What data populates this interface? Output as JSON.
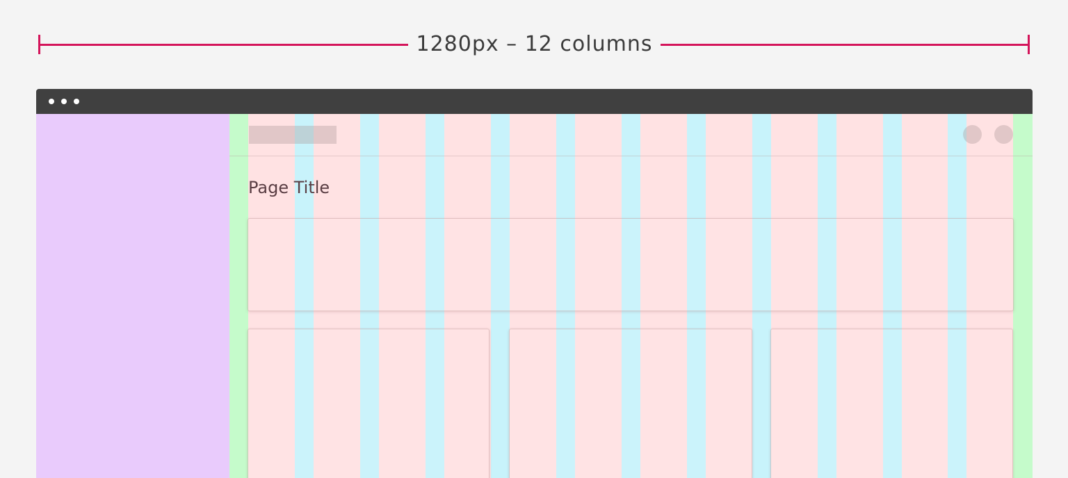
{
  "ruler": {
    "label": "1280px – 12 columns",
    "color": "#d4145a"
  },
  "layout_grid": {
    "columns": 12,
    "colors": {
      "sidebar": "#e9cbfc",
      "margin": "#c5fbcb",
      "column": "#ffe2e3",
      "gutter": "#c8f3fb",
      "titlebar": "#404040"
    }
  },
  "page": {
    "title": "Page Title"
  },
  "icons": {
    "window_controls": [
      "window-dot-icon",
      "window-dot-icon",
      "window-dot-icon"
    ],
    "header_actions": [
      "circle-icon",
      "circle-icon"
    ]
  }
}
